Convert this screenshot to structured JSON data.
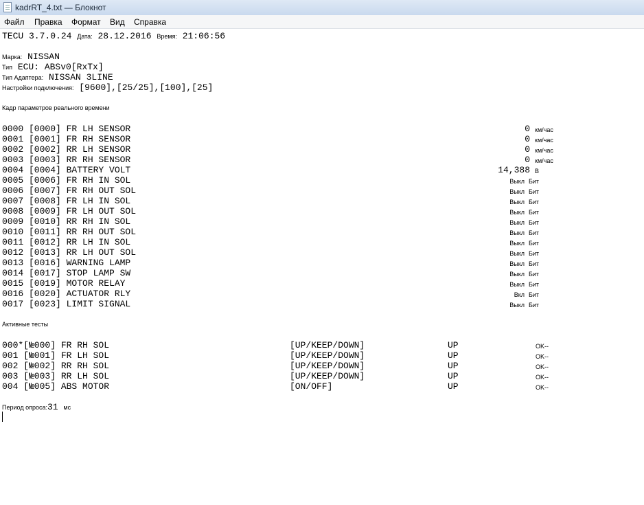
{
  "window": {
    "title": "kadrRT_4.txt — Блокнот",
    "icon": "notepad-icon"
  },
  "menu": [
    "Файл",
    "Правка",
    "Формат",
    "Вид",
    "Справка"
  ],
  "header": {
    "app": "TECU 3.7.0.24",
    "date_label": "Дата:",
    "date": "28.12.2016",
    "time_label": "Время:",
    "time": "21:06:56"
  },
  "info": [
    {
      "label": "Марка:",
      "value": "NISSAN"
    },
    {
      "label": "Тип",
      "value": "ECU: ABSv0[RxTx]"
    },
    {
      "label": "Тип Адаптера:",
      "value": "NISSAN 3LINE"
    },
    {
      "label": "Настройки подключения:",
      "value": "[9600],[25/25],[100],[25]"
    }
  ],
  "realtime_title": "Кадр параметров реального времени",
  "params": [
    {
      "id": "0000 [0000] FR LH SENSOR",
      "value": "0",
      "unit": "км/час"
    },
    {
      "id": "0001 [0001] FR RH SENSOR",
      "value": "0",
      "unit": "км/час"
    },
    {
      "id": "0002 [0002] RR LH SENSOR",
      "value": "0",
      "unit": "км/час"
    },
    {
      "id": "0003 [0003] RR RH SENSOR",
      "value": "0",
      "unit": "км/час"
    },
    {
      "id": "0004 [0004] BATTERY VOLT",
      "value": "14,388",
      "unit": "В"
    },
    {
      "id": "0005 [0006] FR RH IN SOL",
      "value": "Выкл",
      "unit": "Бит"
    },
    {
      "id": "0006 [0007] FR RH OUT SOL",
      "value": "Выкл",
      "unit": "Бит"
    },
    {
      "id": "0007 [0008] FR LH IN SOL",
      "value": "Выкл",
      "unit": "Бит"
    },
    {
      "id": "0008 [0009] FR LH OUT SOL",
      "value": "Выкл",
      "unit": "Бит"
    },
    {
      "id": "0009 [0010] RR RH IN SOL",
      "value": "Выкл",
      "unit": "Бит"
    },
    {
      "id": "0010 [0011] RR RH OUT SOL",
      "value": "Выкл",
      "unit": "Бит"
    },
    {
      "id": "0011 [0012] RR LH IN SOL",
      "value": "Выкл",
      "unit": "Бит"
    },
    {
      "id": "0012 [0013] RR LH OUT SOL",
      "value": "Выкл",
      "unit": "Бит"
    },
    {
      "id": "0013 [0016] WARNING LAMP",
      "value": "Выкл",
      "unit": "Бит"
    },
    {
      "id": "0014 [0017] STOP LAMP SW",
      "value": "Выкл",
      "unit": "Бит"
    },
    {
      "id": "0015 [0019] MOTOR RELAY",
      "value": "Выкл",
      "unit": "Бит"
    },
    {
      "id": "0016 [0020] ACTUATOR RLY",
      "value": "Вкл",
      "unit": "Бит"
    },
    {
      "id": "0017 [0023] LIMIT SIGNAL",
      "value": "Выкл",
      "unit": "Бит"
    }
  ],
  "tests_title": "Активные тесты",
  "tests": [
    {
      "id": "000*[№000] FR RH SOL",
      "modes": "[UP/KEEP/DOWN]",
      "state": "UP",
      "result": "OK--"
    },
    {
      "id": "001 [№001] FR LH SOL",
      "modes": "[UP/KEEP/DOWN]",
      "state": "UP",
      "result": "OK--"
    },
    {
      "id": "002 [№002] RR RH SOL",
      "modes": "[UP/KEEP/DOWN]",
      "state": "UP",
      "result": "OK--"
    },
    {
      "id": "003 [№003] RR LH SOL",
      "modes": "[UP/KEEP/DOWN]",
      "state": "UP",
      "result": "OK--"
    },
    {
      "id": "004 [№005] ABS MOTOR",
      "modes": "[ON/OFF]",
      "state": "UP",
      "result": "OK--"
    }
  ],
  "footer": {
    "label": "Период опроса:",
    "value": "31",
    "unit": "мс"
  }
}
